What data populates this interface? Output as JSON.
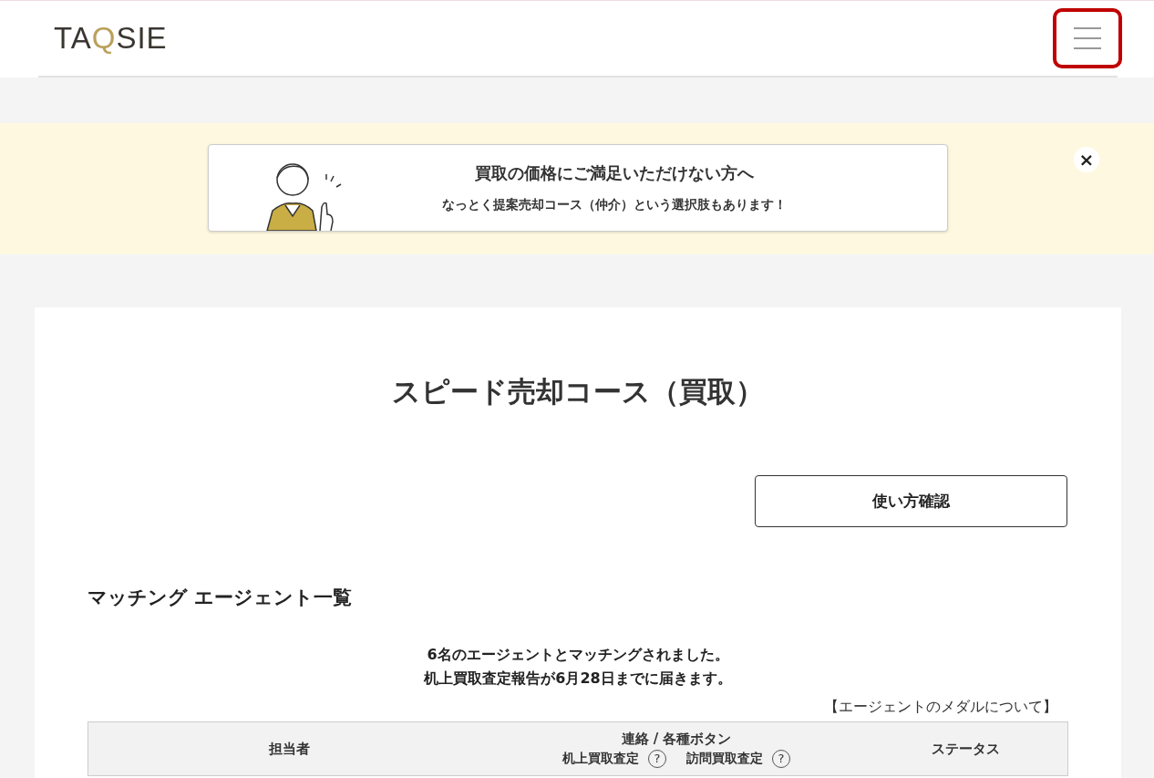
{
  "header": {
    "logo": [
      {
        "text": "TA",
        "accent": false
      },
      {
        "text": "Q",
        "accent": true
      },
      {
        "text": "SIE",
        "accent": false
      }
    ],
    "menu_button": {
      "highlighted": true
    }
  },
  "promo_banner": {
    "title": "買取の価格にご満足いただけない方へ",
    "subtitle": "なっとく提案売却コース（仲介）という選択肢もあります！",
    "close": "×"
  },
  "page": {
    "title": "スピード売却コース（買取）",
    "guide_button": "使い方確認",
    "section_heading": "マッチング エージェント一覧",
    "messages": [
      "6名のエージェントとマッチングされました。",
      "机上買取査定報告が6月28日までに届きます。"
    ],
    "medal_link": "【エージェントのメダルについて】",
    "table": {
      "columns": [
        {
          "label": "担当者"
        },
        {
          "label": "連絡 / 各種ボタン",
          "sub": [
            {
              "label": "机上買取査定",
              "help": "?"
            },
            {
              "label": "訪問買取査定",
              "help": "?"
            }
          ]
        },
        {
          "label": "ステータス"
        }
      ]
    }
  }
}
